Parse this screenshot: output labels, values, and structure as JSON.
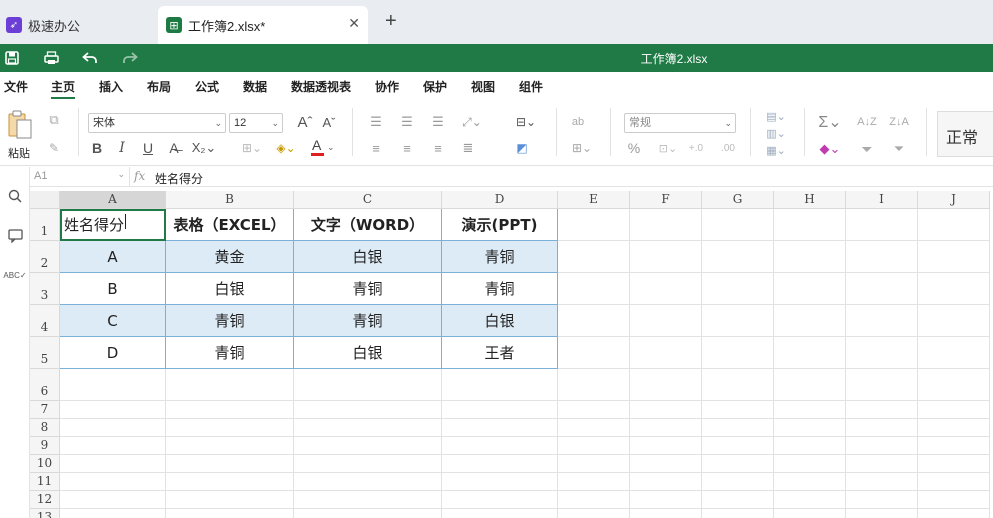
{
  "app_tab": {
    "label": "极速办公"
  },
  "file_tab": {
    "label": "工作簿2.xlsx*",
    "close": "✕"
  },
  "new_tab": "+",
  "title_bar": {
    "title": "工作簿2.xlsx"
  },
  "menu": {
    "items": [
      "文件",
      "主页",
      "插入",
      "布局",
      "公式",
      "数据",
      "数据透视表",
      "协作",
      "保护",
      "视图",
      "组件"
    ],
    "active": "主页"
  },
  "ribbon": {
    "paste_label": "粘贴",
    "font_name": "宋体",
    "font_size": "12",
    "number_format": "常规",
    "cell_style": "正常",
    "colors": {
      "font_color": "#e02020",
      "accent": "#1f7a45"
    }
  },
  "formula_bar": {
    "cell_ref": "A1",
    "fx": "fx",
    "value": "姓名得分"
  },
  "sheet": {
    "columns": [
      "A",
      "B",
      "C",
      "D",
      "E",
      "F",
      "G",
      "H",
      "I",
      "J"
    ],
    "rows": [
      "1",
      "2",
      "3",
      "4",
      "5",
      "6",
      "7",
      "8",
      "9",
      "10",
      "11",
      "12",
      "13"
    ],
    "table": [
      [
        "姓名得分",
        "表格（EXCEL）",
        "文字（WORD）",
        "演示(PPT)"
      ],
      [
        "A",
        "黄金",
        "白银",
        "青铜"
      ],
      [
        "B",
        "白银",
        "青铜",
        "青铜"
      ],
      [
        "C",
        "青铜",
        "青铜",
        "白银"
      ],
      [
        "D",
        "青铜",
        "白银",
        "王者"
      ]
    ]
  }
}
